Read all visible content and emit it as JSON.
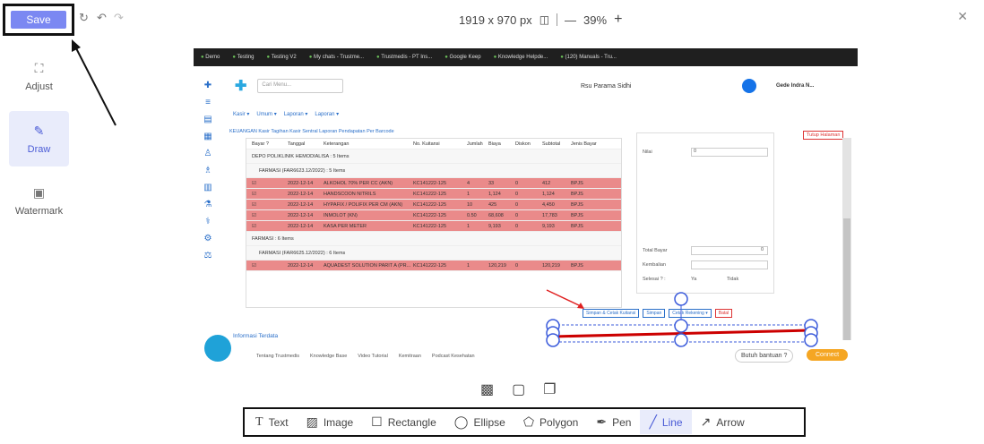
{
  "topbar": {
    "save_label": "Save",
    "redo_glyph": "↻",
    "undo_glyph": "↶",
    "redo2_glyph": "↷",
    "dimensions": "1919 x 970 px",
    "zoom": "39%",
    "zoom_out_glyph": "—",
    "zoom_in_glyph": "+",
    "close_glyph": "✕"
  },
  "sidebar": [
    {
      "label": "Adjust",
      "icon": "crop-icon",
      "glyph": "⛶",
      "active": false
    },
    {
      "label": "Draw",
      "icon": "pencil-square-icon",
      "glyph": "✎",
      "active": true
    },
    {
      "label": "Watermark",
      "icon": "image-icon",
      "glyph": "▣",
      "active": false
    }
  ],
  "screenshot": {
    "bookmarks": [
      "Demo",
      "Testing",
      "Testing V2",
      "My chats - Trustme...",
      "Trustmedis - PT Ins...",
      "Google Keep",
      "Knowledge Helpde...",
      "(120) Manuals - Tru..."
    ],
    "search_placeholder": "Cari Menu...",
    "hospital": "Rsu Parama Sidhi",
    "user": "Gede Indra N...",
    "menu": [
      "Kasir ▾",
      "Umum ▾",
      "Laporan ▾",
      "Laporan ▾"
    ],
    "breadcrumb": "KEUANGAN  Kasir Tagihan  Kasir Sentral  Laporan Pendapatan Per Barcode",
    "table_header": [
      "Bayar ?",
      "Tanggal",
      "Keterangan",
      "No. Kuitansi",
      "Jumlah",
      "Biaya",
      "Diskon",
      "Subtotal",
      "Jenis Bayar"
    ],
    "group1": "DEPO POLIKLINIK HEMODIALISA : 5 Items",
    "group1_sub": "FARMASI (FAR6623.12/2022) : 5 Items",
    "rows1": [
      [
        "2022-12-14",
        "ALKOHOL 70% PER CC (AKN)",
        "KC141222-125",
        "4",
        "33",
        "0",
        "412",
        "BPJS"
      ],
      [
        "2022-12-14",
        "HANDSCOON NITRILS",
        "KC141222-125",
        "1",
        "1,124",
        "0",
        "1,124",
        "BPJS"
      ],
      [
        "2022-12-14",
        "HYPAFIX / POLIFIX PER CM (AKN)",
        "KC141222-125",
        "10",
        "425",
        "0",
        "4,450",
        "BPJS"
      ],
      [
        "2022-12-14",
        "INMOLOT (KN)",
        "KC141222-125",
        "0.50",
        "68,608",
        "0",
        "17,783",
        "BPJS"
      ],
      [
        "2022-12-14",
        "KASA PER METER",
        "KC141222-125",
        "1",
        "9,193",
        "0",
        "9,193",
        "BPJS"
      ]
    ],
    "group2": "FARMASI : 6 Items",
    "group2_sub": "FARMASI (FAR6625.12/2022) : 6 Items",
    "rows2": [
      [
        "2022-12-14",
        "AQUADEST SOLUTION PARIT A (PR...",
        "KC141222-125",
        "1",
        "120,219",
        "0",
        "120,219",
        "BPJS"
      ]
    ],
    "panel_nilai": "Nilai",
    "panel_nilai_value": "0",
    "panel_total": "Total Bayar",
    "panel_total_value": "0",
    "panel_kembalian": "Kembalian",
    "panel_selesai": "Selesai ? :",
    "panel_ya": "Ya",
    "panel_tidak": "Tidak",
    "tutup": "Tutup Halaman",
    "buttons": [
      "Simpan & Cetak Kuitansi",
      "Simpan",
      "Cetak Rekening ▾",
      "Batal"
    ],
    "info": "Informasi Terdata",
    "footer": [
      "Tentang Trustmedis",
      "Knowledge Base",
      "Video Tutorial",
      "Kemitraan",
      "Podcast Kesehatan"
    ],
    "help": "Butuh bantuan ?",
    "connect": "Connect"
  },
  "mid_icons": [
    "checker-icon",
    "frame-icon",
    "layers-icon"
  ],
  "tools": [
    {
      "label": "Text",
      "icon": "text-icon",
      "glyph": "T",
      "active": false
    },
    {
      "label": "Image",
      "icon": "image-icon",
      "glyph": "▨",
      "active": false
    },
    {
      "label": "Rectangle",
      "icon": "rectangle-icon",
      "glyph": "☐",
      "active": false
    },
    {
      "label": "Ellipse",
      "icon": "ellipse-icon",
      "glyph": "◯",
      "active": false
    },
    {
      "label": "Polygon",
      "icon": "polygon-icon",
      "glyph": "⬠",
      "active": false
    },
    {
      "label": "Pen",
      "icon": "pen-icon",
      "glyph": "✒",
      "active": false
    },
    {
      "label": "Line",
      "icon": "line-icon",
      "glyph": "╱",
      "active": true
    },
    {
      "label": "Arrow",
      "icon": "arrow-icon",
      "glyph": "↗",
      "active": false
    }
  ],
  "colors": {
    "accent": "#7b88f2",
    "active_bg": "#e9ecfb",
    "row_red": "#ea8a8a",
    "line_red": "#cc0000",
    "handle_blue": "#3b5bdb"
  }
}
